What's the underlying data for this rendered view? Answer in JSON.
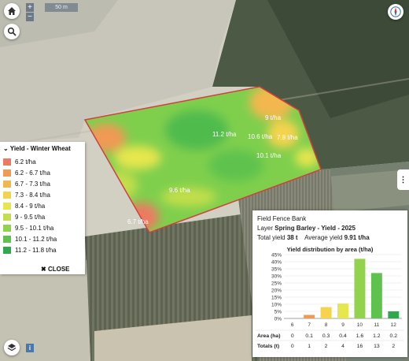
{
  "map": {
    "scale_label": "50 m",
    "zoom_in": "+",
    "zoom_out": "−",
    "field_labels": [
      "11.2 t/ha",
      "10.6 t/ha",
      "9 t/ha",
      "7.8 t/ha",
      "10.1 t/ha",
      "9.6 t/ha",
      "6.7 t/ha"
    ]
  },
  "legend": {
    "title": "Yield - Winter Wheat",
    "items": [
      {
        "label": "6.2 t/ha",
        "color": "#ec7a62"
      },
      {
        "label": "6.2 - 6.7 t/ha",
        "color": "#f09a55"
      },
      {
        "label": "6.7 - 7.3 t/ha",
        "color": "#f2b84e"
      },
      {
        "label": "7.3 - 8.4 t/ha",
        "color": "#f5d34d"
      },
      {
        "label": "8.4 - 9 t/ha",
        "color": "#e6e64e"
      },
      {
        "label": "9 - 9.5 t/ha",
        "color": "#c2de4c"
      },
      {
        "label": "9.5 - 10.1 t/ha",
        "color": "#93d24c"
      },
      {
        "label": "10.1 - 11.2 t/ha",
        "color": "#5fc24e"
      },
      {
        "label": "11.2 - 11.8 t/ha",
        "color": "#2fa84e"
      }
    ],
    "close_label": "CLOSE"
  },
  "panel": {
    "field_name": "Field Fence Bank",
    "layer_prefix": "Layer",
    "layer_value": "Spring Barley - Yield - 2025",
    "total_yield_label": "Total yield",
    "total_yield_value": "38 t",
    "avg_yield_label": "Average yield",
    "avg_yield_value": "9.91 t/ha",
    "chart_title": "Yield distribution by area (t/ha)"
  },
  "chart_data": {
    "type": "bar",
    "title": "Yield distribution by area (t/ha)",
    "categories": [
      "6",
      "7",
      "8",
      "9",
      "10",
      "11",
      "12"
    ],
    "values": [
      0,
      2.5,
      8,
      10.5,
      42,
      32,
      5
    ],
    "colors": [
      "#ec7a62",
      "#f09a55",
      "#f5d34d",
      "#e6e64e",
      "#93d24c",
      "#5fc24e",
      "#2fa84e"
    ],
    "ylim": [
      0,
      45
    ],
    "yticks": [
      "0%",
      "5%",
      "10%",
      "15%",
      "20%",
      "25%",
      "30%",
      "35%",
      "40%",
      "45%"
    ],
    "table": {
      "rows": [
        {
          "label": "Area (ha)",
          "values": [
            "0",
            "0.1",
            "0.3",
            "0.4",
            "1.6",
            "1.2",
            "0.2"
          ]
        },
        {
          "label": "Totals (t)",
          "values": [
            "0",
            "1",
            "2",
            "4",
            "16",
            "13",
            "2"
          ]
        }
      ]
    }
  }
}
